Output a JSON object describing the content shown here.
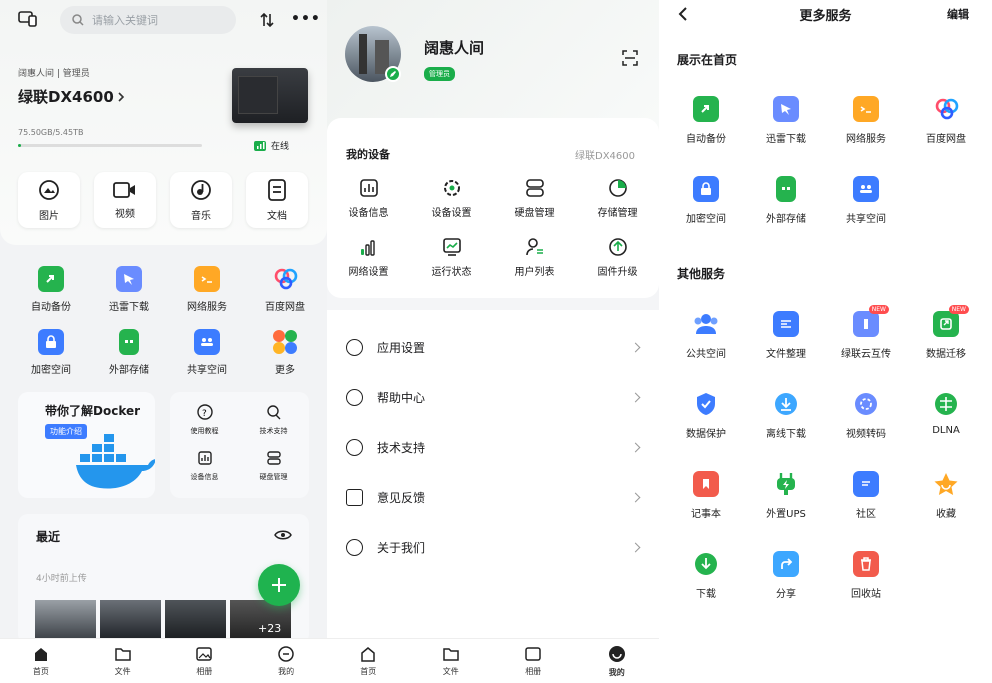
{
  "home": {
    "search_placeholder": "请输入关键词",
    "user_line": "阔惠人间 | 管理员",
    "device_name": "绿联DX4600",
    "storage": "75.50GB/5.45TB",
    "storage_fraction": 0.014,
    "status": "在线",
    "quick": [
      "图片",
      "视频",
      "音乐",
      "文档"
    ],
    "services": [
      "自动备份",
      "迅雷下载",
      "网络服务",
      "百度网盘",
      "加密空间",
      "外部存储",
      "共享空间",
      "更多"
    ],
    "docker_title": "带你了解Docker",
    "docker_badge": "功能介绍",
    "mini": [
      "使用教程",
      "技术支持",
      "设备信息",
      "硬盘管理"
    ],
    "recent_title": "最近",
    "recent_sub": "4小时前上传",
    "more_count": "+23",
    "nav": [
      "首页",
      "文件",
      "相册",
      "我的"
    ]
  },
  "me": {
    "name": "阔惠人间",
    "role": "管理员",
    "section_title": "我的设备",
    "device_name": "绿联DX4600",
    "devices": [
      "设备信息",
      "设备设置",
      "硬盘管理",
      "存储管理",
      "网络设置",
      "运行状态",
      "用户列表",
      "固件升级"
    ],
    "menu": [
      "应用设置",
      "帮助中心",
      "技术支持",
      "意见反馈",
      "关于我们"
    ],
    "nav": [
      "首页",
      "文件",
      "相册",
      "我的"
    ]
  },
  "more": {
    "title": "更多服务",
    "edit": "编辑",
    "sec1": "展示在首页",
    "sec1_items": [
      "自动备份",
      "迅雷下载",
      "网络服务",
      "百度网盘",
      "加密空间",
      "外部存储",
      "共享空间"
    ],
    "sec2": "其他服务",
    "sec2_items": [
      "公共空间",
      "文件整理",
      "绿联云互传",
      "数据迁移",
      "数据保护",
      "离线下载",
      "视频转码",
      "DLNA",
      "记事本",
      "外置UPS",
      "社区",
      "收藏",
      "下载",
      "分享",
      "回收站"
    ],
    "new_label": "NEW"
  },
  "colors": {
    "green": "#1aad4a",
    "blue": "#3d7cff",
    "orange": "#ff9f1c",
    "red": "#f25b4c"
  }
}
